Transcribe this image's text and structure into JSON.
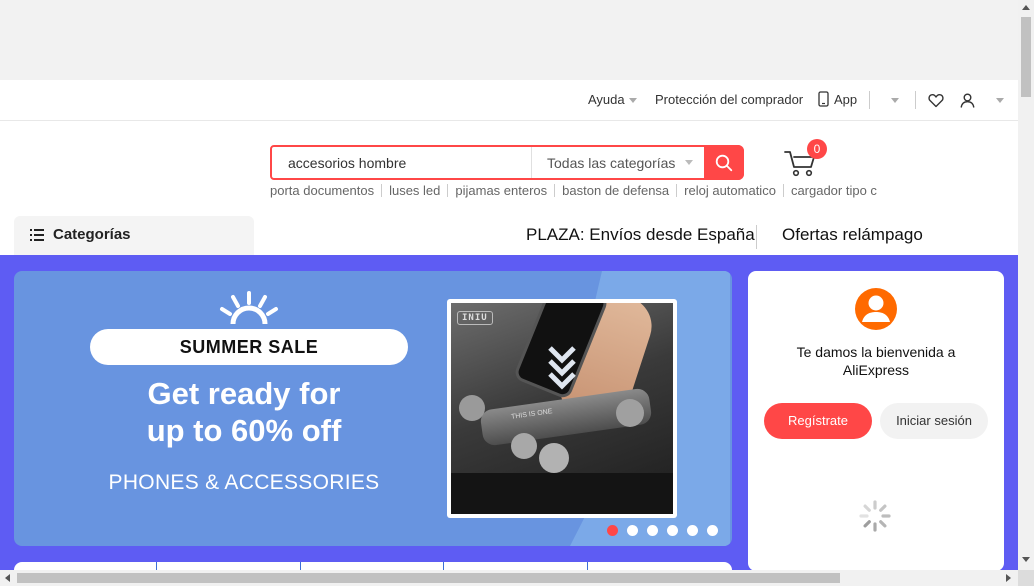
{
  "utility_bar": {
    "help_label": "Ayuda",
    "buyer_protection_label": "Protección del comprador",
    "app_label": "App"
  },
  "search": {
    "value": "accesorios hombre",
    "category_select": "Todas las categorías",
    "suggestions": [
      "porta documentos",
      "luses led",
      "pijamas enteros",
      "baston de defensa",
      "reloj automatico",
      "cargador tipo c"
    ]
  },
  "cart": {
    "count": "0"
  },
  "nav": {
    "categories_label": "Categorías",
    "plaza_label": "PLAZA: Envíos desde España",
    "flash_deals_label": "Ofertas relámpago"
  },
  "banner": {
    "pill": "SUMMER SALE",
    "headline_line1": "Get ready for",
    "headline_line2": "up to 60% off",
    "subhead": "PHONES & ACCESSORIES",
    "product_brand": "INIU",
    "product_model": "THIS IS ONE",
    "slides_total": 6,
    "active_slide": 1
  },
  "welcome": {
    "text_line1": "Te damos la bienvenida a",
    "text_line2": "AliExpress",
    "register_label": "Regístrate",
    "login_label": "Iniciar sesión"
  },
  "colors": {
    "accent": "#ff4747",
    "main_bg": "#5e5cf3",
    "banner_bg": "#6894e0",
    "avatar": "#ff6a00"
  }
}
